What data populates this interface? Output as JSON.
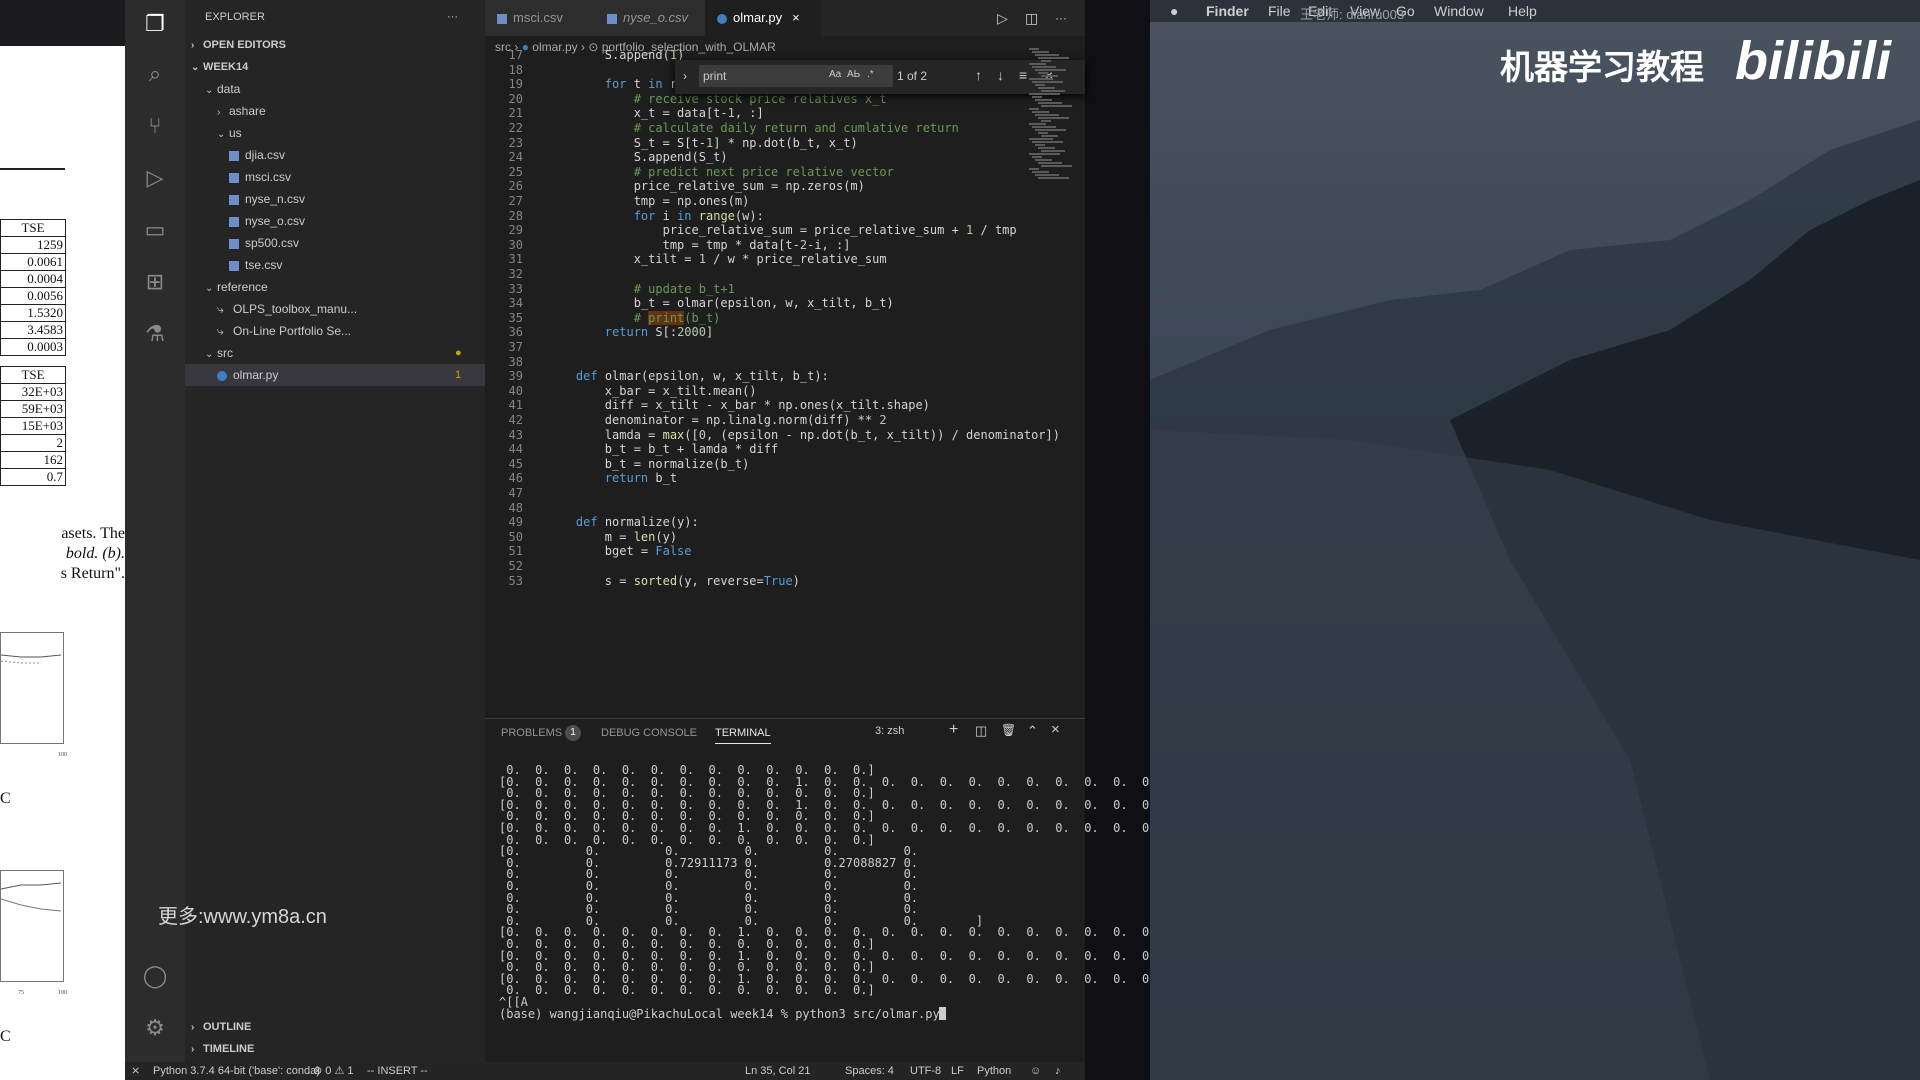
{
  "paper": {
    "table1_header": "TSE",
    "table1_values": [
      "1259",
      "0.0061",
      "0.0004",
      "0.0056",
      "1.5320",
      "3.4583",
      "0.0003"
    ],
    "table2_header": "TSE",
    "table2_values": [
      "32E+03",
      "59E+03",
      "15E+03",
      "2",
      "162",
      "0.7"
    ],
    "text_lines": [
      "asets.  The",
      "bold.  (b).",
      "s Return\"."
    ],
    "axis_label_1": "100",
    "axis_label_2a": "75",
    "axis_label_2b": "100",
    "edge_letter_1": "C",
    "edge_letter_2": "C"
  },
  "sidebar": {
    "explorer_title": "EXPLORER",
    "explorer_more": "···",
    "open_editors": "OPEN EDITORS",
    "workspace": "WEEK14",
    "tree": [
      {
        "label": "data",
        "kind": "folder-open",
        "depth": 1
      },
      {
        "label": "ashare",
        "kind": "folder-closed",
        "depth": 2
      },
      {
        "label": "us",
        "kind": "folder-open",
        "depth": 2
      },
      {
        "label": "djia.csv",
        "kind": "file",
        "depth": 3
      },
      {
        "label": "msci.csv",
        "kind": "file",
        "depth": 3
      },
      {
        "label": "nyse_n.csv",
        "kind": "file",
        "depth": 3
      },
      {
        "label": "nyse_o.csv",
        "kind": "file",
        "depth": 3
      },
      {
        "label": "sp500.csv",
        "kind": "file",
        "depth": 3
      },
      {
        "label": "tse.csv",
        "kind": "file",
        "depth": 3
      },
      {
        "label": "reference",
        "kind": "folder-open",
        "depth": 1
      },
      {
        "label": "OLPS_toolbox_manu...",
        "kind": "link",
        "depth": 2
      },
      {
        "label": "On-Line Portfolio Se...",
        "kind": "link",
        "depth": 2
      },
      {
        "label": "src",
        "kind": "folder-open",
        "depth": 1,
        "badge": "●"
      },
      {
        "label": "olmar.py",
        "kind": "py",
        "depth": 2,
        "badge": "1"
      }
    ],
    "outline": "OUTLINE",
    "timeline": "TIMELINE"
  },
  "tabs": [
    {
      "label": "msci.csv",
      "active": false
    },
    {
      "label": "nyse_o.csv",
      "active": false
    },
    {
      "label": "olmar.py",
      "active": true,
      "close": "×"
    }
  ],
  "editor_actions": {
    "run": "▷",
    "split": "◫",
    "more": "···"
  },
  "breadcrumb": [
    "src",
    "olmar.py",
    "portfolio_selection_with_OLMAR"
  ],
  "find": {
    "query": "print",
    "result": "1 of 2",
    "opt_case": "Aa",
    "opt_word": "AЬ",
    "opt_regex": ".*"
  },
  "code": [
    {
      "n": "17",
      "t": "        S.append(1)"
    },
    {
      "n": "18",
      "t": ""
    },
    {
      "n": "19",
      "t": "        for t in range(1, n+1):"
    },
    {
      "n": "20",
      "t": "            # receive stock price relatives x_t"
    },
    {
      "n": "21",
      "t": "            x_t = data[t-1, :]"
    },
    {
      "n": "22",
      "t": "            # calculate daily return and cumlative return"
    },
    {
      "n": "23",
      "t": "            S_t = S[t-1] * np.dot(b_t, x_t)"
    },
    {
      "n": "24",
      "t": "            S.append(S_t)"
    },
    {
      "n": "25",
      "t": "            # predict next price relative vector"
    },
    {
      "n": "26",
      "t": "            price_relative_sum = np.zeros(m)"
    },
    {
      "n": "27",
      "t": "            tmp = np.ones(m)"
    },
    {
      "n": "28",
      "t": "            for i in range(w):"
    },
    {
      "n": "29",
      "t": "                price_relative_sum = price_relative_sum + 1 / tmp"
    },
    {
      "n": "30",
      "t": "                tmp = tmp * data[t-2-i, :]"
    },
    {
      "n": "31",
      "t": "            x_tilt = 1 / w * price_relative_sum"
    },
    {
      "n": "32",
      "t": ""
    },
    {
      "n": "33",
      "t": "            # update b_t+1"
    },
    {
      "n": "34",
      "t": "            b_t = olmar(epsilon, w, x_tilt, b_t)"
    },
    {
      "n": "35",
      "t": "            # print(b_t)"
    },
    {
      "n": "36",
      "t": "        return S[:2000]"
    },
    {
      "n": "37",
      "t": ""
    },
    {
      "n": "38",
      "t": ""
    },
    {
      "n": "39",
      "t": "    def olmar(epsilon, w, x_tilt, b_t):"
    },
    {
      "n": "40",
      "t": "        x_bar = x_tilt.mean()"
    },
    {
      "n": "41",
      "t": "        diff = x_tilt - x_bar * np.ones(x_tilt.shape)"
    },
    {
      "n": "42",
      "t": "        denominator = np.linalg.norm(diff) ** 2"
    },
    {
      "n": "43",
      "t": "        lamda = max([0, (epsilon - np.dot(b_t, x_tilt)) / denominator])"
    },
    {
      "n": "44",
      "t": "        b_t = b_t + lamda * diff"
    },
    {
      "n": "45",
      "t": "        b_t = normalize(b_t)"
    },
    {
      "n": "46",
      "t": "        return b_t"
    },
    {
      "n": "47",
      "t": ""
    },
    {
      "n": "48",
      "t": ""
    },
    {
      "n": "49",
      "t": "    def normalize(y):"
    },
    {
      "n": "50",
      "t": "        m = len(y)"
    },
    {
      "n": "51",
      "t": "        bget = False"
    },
    {
      "n": "52",
      "t": ""
    },
    {
      "n": "53",
      "t": "        s = sorted(y, reverse=True)"
    }
  ],
  "panel": {
    "tabs": [
      "PROBLEMS",
      "DEBUG CONSOLE",
      "TERMINAL"
    ],
    "problems_badge": "1",
    "terminal_select": "3: zsh",
    "actions": {
      "add": "+",
      "split": "◫",
      "trash": "🗑",
      "maximize": "⌃",
      "close": "×"
    }
  },
  "terminal_lines": [
    " 0.  0.  0.  0.  0.  0.  0.  0.  0.  0.  0.  0.  0.]",
    "[0.  0.  0.  0.  0.  0.  0.  0.  0.  0.  1.  0.  0.  0.  0.  0.  0.  0.  0.  0.  0.  0.  0.",
    " 0.  0.  0.  0.  0.  0.  0.  0.  0.  0.  0.  0.  0.]",
    "[0.  0.  0.  0.  0.  0.  0.  0.  0.  0.  1.  0.  0.  0.  0.  0.  0.  0.  0.  0.  0.  0.  0.",
    " 0.  0.  0.  0.  0.  0.  0.  0.  0.  0.  0.  0.  0.]",
    "[0.  0.  0.  0.  0.  0.  0.  0.  1.  0.  0.  0.  0.  0.  0.  0.  0.  0.  0.  0.  0.  0.  0.",
    " 0.  0.  0.  0.  0.  0.  0.  0.  0.  0.  0.  0.  0.]",
    "[0.         0.         0.         0.         0.         0.",
    " 0.         0.         0.72911173 0.         0.27088827 0.",
    " 0.         0.         0.         0.         0.         0.",
    " 0.         0.         0.         0.         0.         0.",
    " 0.         0.         0.         0.         0.         0.",
    " 0.         0.         0.         0.         0.         0.",
    " 0.         0.         0.         0.         0.         0.        ]",
    "[0.  0.  0.  0.  0.  0.  0.  0.  1.  0.  0.  0.  0.  0.  0.  0.  0.  0.  0.  0.  0.  0.  0.",
    " 0.  0.  0.  0.  0.  0.  0.  0.  0.  0.  0.  0.  0.]",
    "[0.  0.  0.  0.  0.  0.  0.  0.  1.  0.  0.  0.  0.  0.  0.  0.  0.  0.  0.  0.  0.  0.  0.",
    " 0.  0.  0.  0.  0.  0.  0.  0.  0.  0.  0.  0.  0.]",
    "[0.  0.  0.  0.  0.  0.  0.  0.  1.  0.  0.  0.  0.  0.  0.  0.  0.  0.  0.  0.  0.  0.  0.",
    " 0.  0.  0.  0.  0.  0.  0.  0.  0.  0.  0.  0.  0.]",
    "^[[A",
    "(base) wangjianqiu@PikachuLocal week14 % python3 src/olmar.py"
  ],
  "statusbar": {
    "python": "Python 3.7.4 64-bit ('base': conda)",
    "errors": "⊗ 0 ⚠ 1",
    "mode": "-- INSERT --",
    "position": "Ln 35, Col 21",
    "spaces": "Spaces: 4",
    "encoding": "UTF-8",
    "eol": "LF",
    "language": "Python"
  },
  "desktop": {
    "menu": [
      "Finder",
      "File",
      "Edit",
      "View",
      "Go",
      "Window",
      "Help"
    ],
    "menu_overlay": "王老师: dianru003",
    "watermark": "机器学习教程",
    "logo": "bilibili",
    "overlay_url": "更多:www.ym8a.cn"
  },
  "colors": {
    "accent": "#007acc",
    "editor_bg": "#1e1e1e",
    "sidebar_bg": "#252526",
    "keyword": "#569cd6",
    "comment": "#6a9955"
  }
}
